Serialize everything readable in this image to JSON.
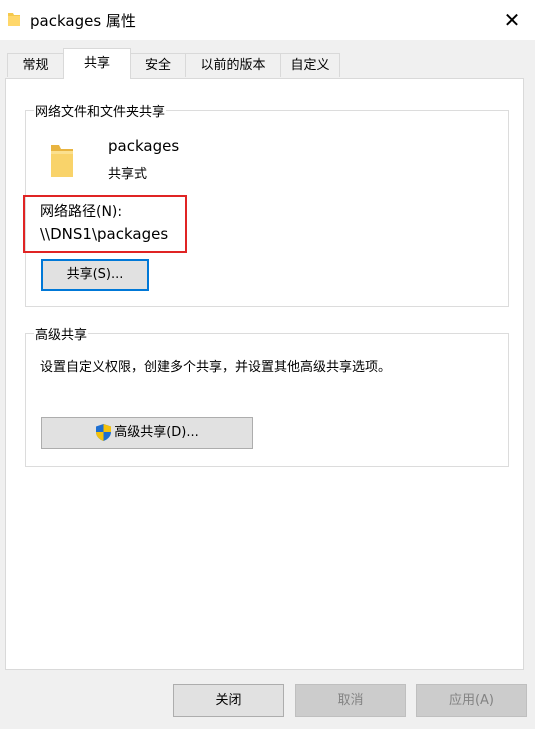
{
  "window": {
    "title": "packages 属性",
    "close_glyph": "✕"
  },
  "tabs": [
    {
      "label": "常规"
    },
    {
      "label": "共享",
      "active": true
    },
    {
      "label": "安全"
    },
    {
      "label": "以前的版本"
    },
    {
      "label": "自定义"
    }
  ],
  "network_share": {
    "group_title": "网络文件和文件夹共享",
    "folder_name": "packages",
    "folder_status": "共享式",
    "path_label": "网络路径(N):",
    "path_value": "\\\\DNS1\\packages",
    "share_button": "共享(S)..."
  },
  "advanced_share": {
    "group_title": "高级共享",
    "description": "设置自定义权限，创建多个共享，并设置其他高级共享选项。",
    "button": "高级共享(D)..."
  },
  "footer": {
    "close_button": "关闭",
    "cancel_button": "取消",
    "apply_button": "应用(A)"
  },
  "colors": {
    "highlight_box": "#e02424",
    "focus_border": "#0078d7",
    "folder_yellow": "#f5c94c"
  },
  "icons": [
    "folder-icon",
    "shield-icon",
    "close-icon"
  ]
}
